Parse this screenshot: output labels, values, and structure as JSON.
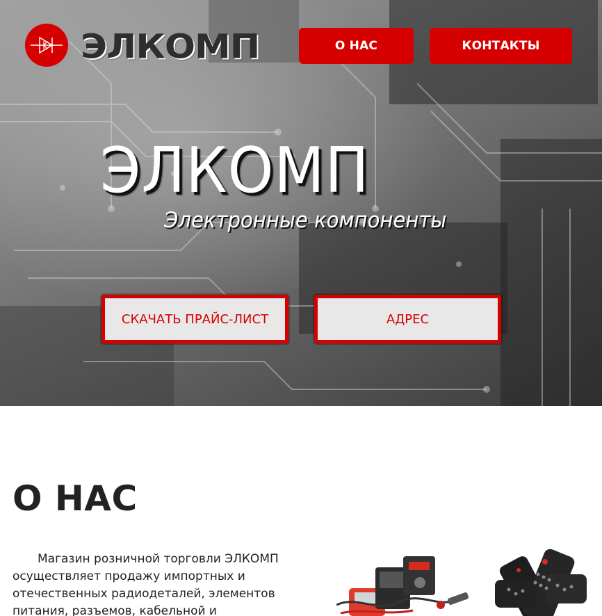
{
  "header": {
    "logo_text": "ЭЛКОМП",
    "nav": [
      {
        "label": "О НАС"
      },
      {
        "label": "КОНТАКТЫ"
      }
    ]
  },
  "hero": {
    "title": "ЭЛКОМП",
    "subtitle": "Электронные компоненты",
    "buttons": [
      {
        "label": "СКАЧАТЬ ПРАЙС-ЛИСТ"
      },
      {
        "label": "АДРЕС"
      }
    ]
  },
  "about": {
    "heading": "О НАС",
    "text": "Магазин розничной торговли ЭЛКОМП осуществляет продажу импортных и отечественных радиодеталей, элементов питания, разъемов, кабельной и"
  },
  "colors": {
    "accent": "#d70000",
    "hero_text": "#ffffff",
    "body_text": "#222222"
  },
  "icons": [
    "logo-diode-icon"
  ]
}
